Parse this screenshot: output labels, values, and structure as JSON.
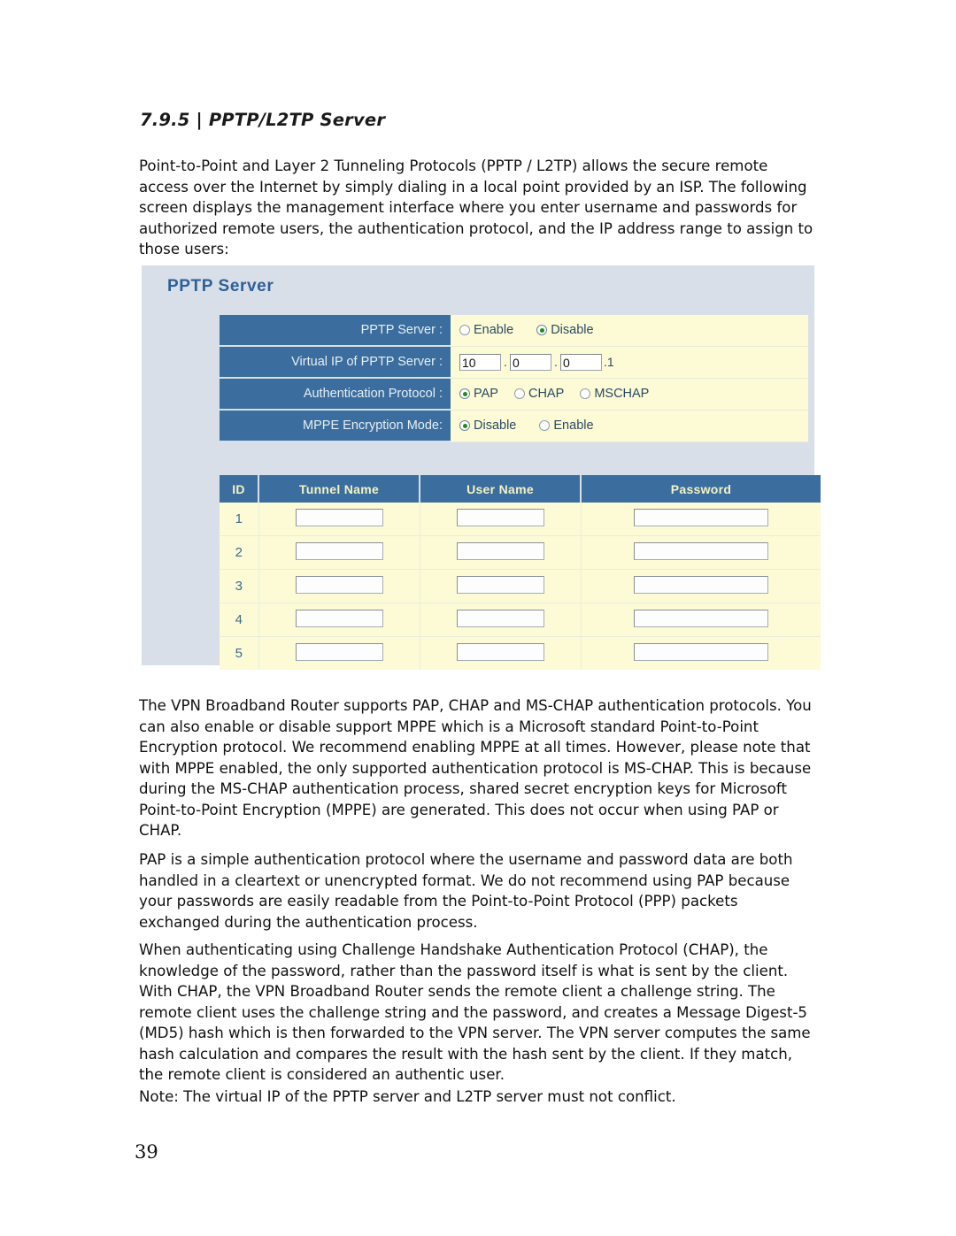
{
  "document": {
    "section_heading": "7.9.5 | PPTP/L2TP Server",
    "page_number": "39",
    "paragraphs": {
      "intro": "Point-to-Point and Layer 2 Tunneling Protocols (PPTP / L2TP) allows the secure remote access over the Internet by simply dialing in a local point provided by an ISP. The following screen displays the management interface where you enter username and passwords for authorized remote users, the authentication protocol, and the IP address range to assign to those users:",
      "auth_protocols": "The VPN Broadband Router supports PAP, CHAP and MS-CHAP authentication protocols. You can also enable or disable support MPPE which is a Microsoft standard Point-to-Point Encryption protocol. We recommend enabling MPPE at all times. However, please note that with MPPE enabled, the only supported authentication protocol is MS-CHAP. This is because during the MS-CHAP authentication process, shared secret encryption keys for Microsoft Point-to-Point Encryption (MPPE) are generated. This does not occur when using PAP or CHAP.",
      "pap": "PAP is a simple authentication protocol where the username and password data are both handled in a cleartext or unencrypted format. We do not recommend using PAP because your passwords are easily readable from the Point-to-Point Protocol (PPP) packets exchanged during the authentication process.",
      "chap": "When authenticating using Challenge Handshake Authentication Protocol (CHAP), the knowledge of the password, rather than the password itself is what is sent by the client. With CHAP, the VPN Broadband Router sends the remote client a challenge string. The remote client uses the challenge string and the password, and creates a Message Digest-5 (MD5) hash which is then forwarded to the VPN server. The VPN server computes the same hash calculation and compares the result with the hash sent by the client. If they match, the remote client is considered an authentic user.",
      "note": "Note: The virtual IP of the PPTP server and L2TP server must not conflict."
    }
  },
  "colors": {
    "panel_bg": "#d8dfe9",
    "label_blue": "#3b6e9e",
    "field_yellow": "#fcfbd6",
    "title_blue": "#2e5f96",
    "header_text": "#f4f3c4",
    "radio_selected": "#1f8a1f"
  },
  "ui_panel": {
    "title": "PPTP Server",
    "settings": [
      {
        "label": "PPTP Server :",
        "type": "radio",
        "options": [
          {
            "label": "Enable",
            "selected": false
          },
          {
            "label": "Disable",
            "selected": true
          }
        ]
      },
      {
        "label": "Virtual IP of PPTP Server :",
        "type": "ip",
        "octets": [
          "10",
          "0",
          "0"
        ],
        "separator": ".",
        "suffix": ".1"
      },
      {
        "label": "Authentication Protocol :",
        "type": "radio",
        "options": [
          {
            "label": "PAP",
            "selected": true
          },
          {
            "label": "CHAP",
            "selected": false
          },
          {
            "label": "MSCHAP",
            "selected": false
          }
        ]
      },
      {
        "label": "MPPE Encryption Mode:",
        "type": "radio",
        "options": [
          {
            "label": "Disable",
            "selected": true
          },
          {
            "label": "Enable",
            "selected": false
          }
        ]
      }
    ],
    "tunnel_table": {
      "columns": [
        "ID",
        "Tunnel Name",
        "User Name",
        "Password"
      ],
      "rows": [
        {
          "id": "1",
          "tunnel_name": "",
          "user_name": "",
          "password": ""
        },
        {
          "id": "2",
          "tunnel_name": "",
          "user_name": "",
          "password": ""
        },
        {
          "id": "3",
          "tunnel_name": "",
          "user_name": "",
          "password": ""
        },
        {
          "id": "4",
          "tunnel_name": "",
          "user_name": "",
          "password": ""
        },
        {
          "id": "5",
          "tunnel_name": "",
          "user_name": "",
          "password": ""
        }
      ]
    }
  }
}
